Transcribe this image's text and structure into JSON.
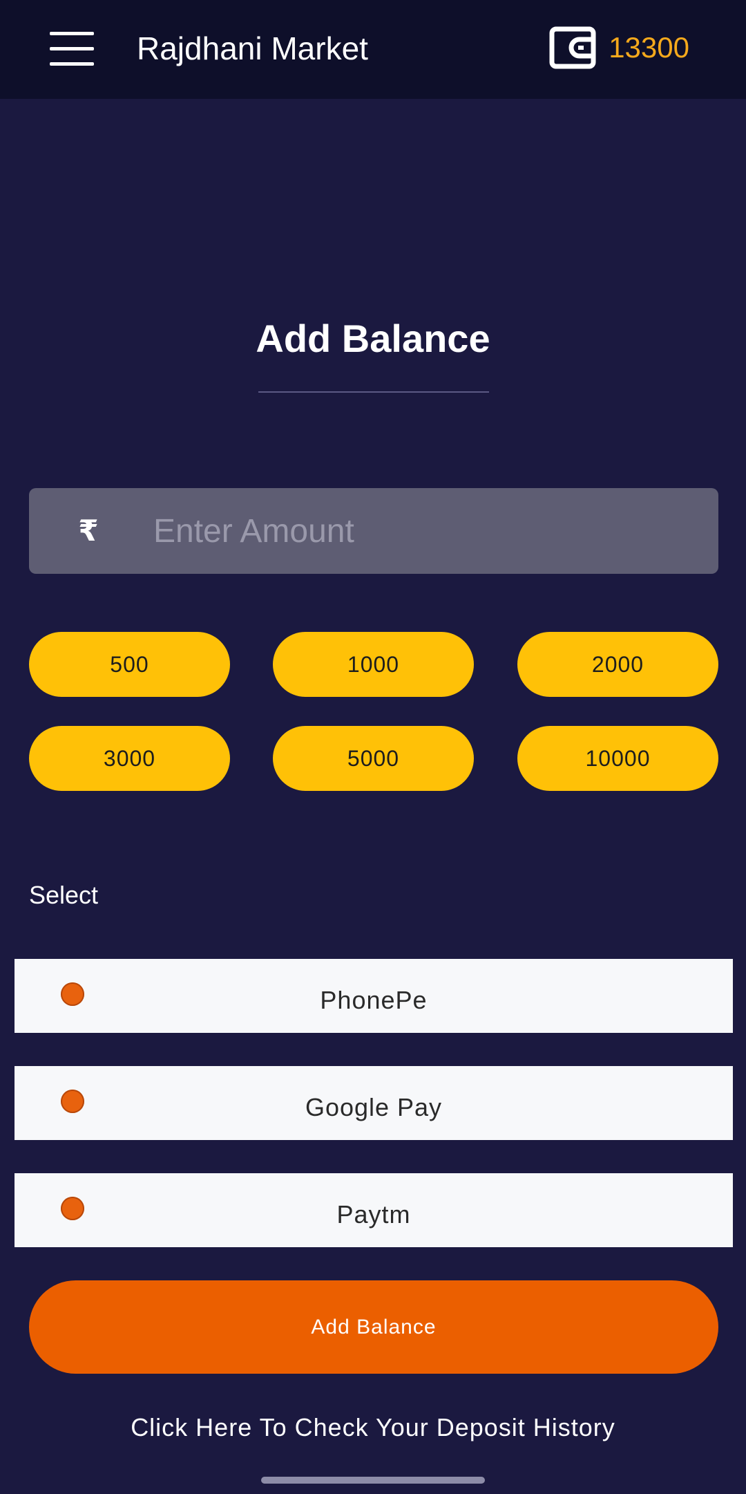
{
  "header": {
    "title": "Rajdhani Market",
    "wallet_balance": "13300"
  },
  "main": {
    "title": "Add Balance",
    "amount_input": {
      "placeholder": "Enter Amount",
      "value": "",
      "currency_icon": "rupee-icon"
    },
    "quick_amounts": [
      "500",
      "1000",
      "2000",
      "3000",
      "5000",
      "10000"
    ],
    "select_label": "Select",
    "payment_options": [
      {
        "label": "PhonePe",
        "selected": true
      },
      {
        "label": "Google Pay",
        "selected": true
      },
      {
        "label": "Paytm",
        "selected": true
      }
    ],
    "submit_label": "Add Balance",
    "history_link": "Click Here To Check Your Deposit History"
  },
  "icons": {
    "menu": "hamburger-menu-icon",
    "wallet": "wallet-icon",
    "currency": "rupee-icon"
  },
  "colors": {
    "background": "#1b1940",
    "header_background": "#0e0f2a",
    "wallet_balance": "#f5a91c",
    "chip": "#ffc107",
    "primary_button": "#eb5f00",
    "radio": "#e8620e",
    "input_background": "#5e5d73"
  }
}
